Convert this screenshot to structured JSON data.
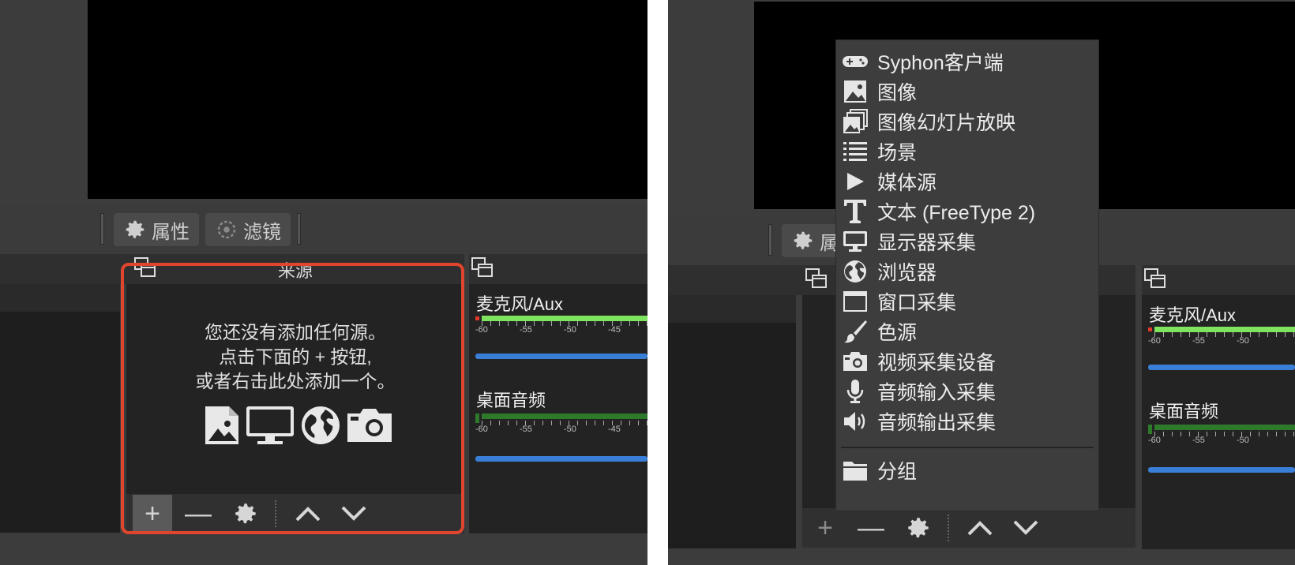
{
  "toolbar": {
    "properties_label": "属性",
    "filters_label": "滤镜",
    "properties_partial": "属"
  },
  "sources_dock": {
    "title": "来源",
    "empty_message_lines": [
      "您还没有添加任何源。",
      "点击下面的 + 按钮,",
      "或者右击此处添加一个。"
    ],
    "empty_icons": [
      "image-icon",
      "monitor-icon",
      "globe-icon",
      "camera-icon"
    ],
    "buttons": {
      "add": "+",
      "remove": "—"
    }
  },
  "mixer": {
    "channels": [
      {
        "name": "麦克风/Aux",
        "ticks": [
          "-60",
          "-55",
          "-50",
          "-45"
        ],
        "meter_color": "#7ee35e"
      },
      {
        "name": "桌面音频",
        "ticks": [
          "-60",
          "-55",
          "-50",
          "-45"
        ],
        "meter_color": "#2f7a2a"
      }
    ],
    "slider_color": "#3a7fd7"
  },
  "add_source_menu": {
    "items": [
      {
        "label": "Syphon客户端",
        "icon": "gamepad-icon"
      },
      {
        "label": "图像",
        "icon": "image-icon"
      },
      {
        "label": "图像幻灯片放映",
        "icon": "slideshow-icon"
      },
      {
        "label": "场景",
        "icon": "list-icon"
      },
      {
        "label": "媒体源",
        "icon": "play-icon"
      },
      {
        "label": "文本 (FreeType 2)",
        "icon": "text-icon"
      },
      {
        "label": "显示器采集",
        "icon": "monitor-icon"
      },
      {
        "label": "浏览器",
        "icon": "globe-icon"
      },
      {
        "label": "窗口采集",
        "icon": "window-icon"
      },
      {
        "label": "色源",
        "icon": "brush-icon"
      },
      {
        "label": "视频采集设备",
        "icon": "camera-icon"
      },
      {
        "label": "音频输入采集",
        "icon": "microphone-icon"
      },
      {
        "label": "音频输出采集",
        "icon": "speaker-icon"
      }
    ],
    "group_item": {
      "label": "分组",
      "icon": "folder-icon"
    }
  },
  "colors": {
    "highlight": "#e0462e",
    "preview": "#000000",
    "panel": "#3c3c3c"
  }
}
